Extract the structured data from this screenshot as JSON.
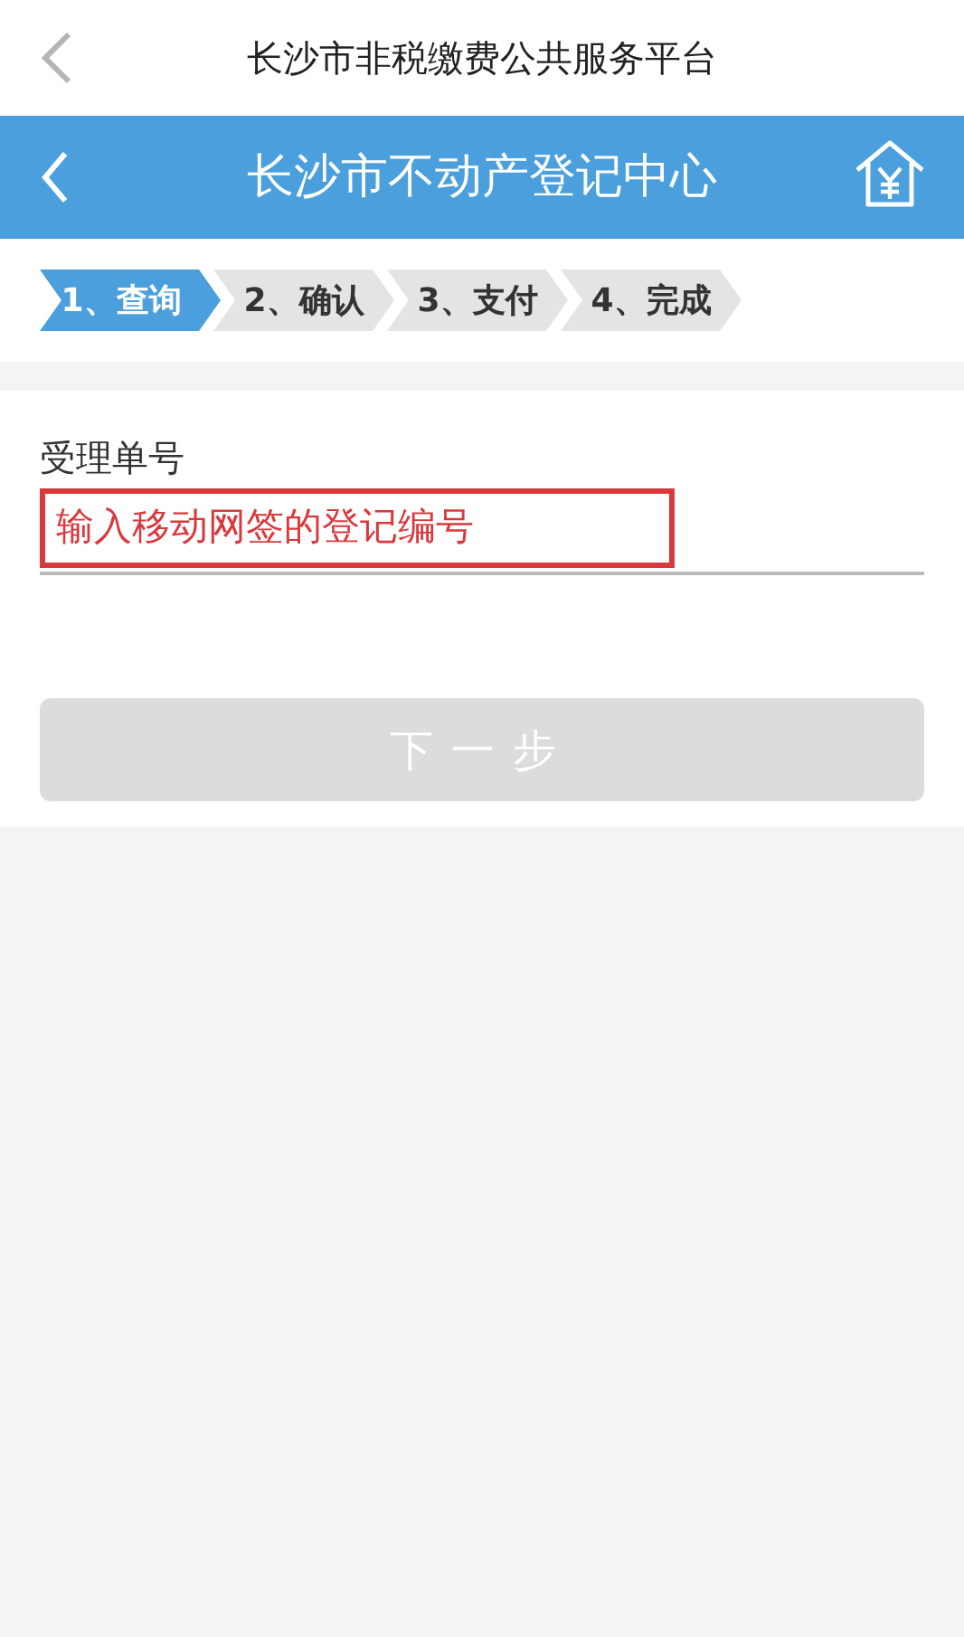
{
  "top_bar": {
    "title": "长沙市非税缴费公共服务平台"
  },
  "header": {
    "title": "长沙市不动产登记中心"
  },
  "steps": [
    {
      "label": "1、查询",
      "selected": true
    },
    {
      "label": "2、确认",
      "selected": false
    },
    {
      "label": "3、支付",
      "selected": false
    },
    {
      "label": "4、完成",
      "selected": false
    }
  ],
  "form": {
    "label": "受理单号",
    "annotation": "输入移动网签的登记编号"
  },
  "next_button": {
    "label": "下一步",
    "disabled": true
  }
}
